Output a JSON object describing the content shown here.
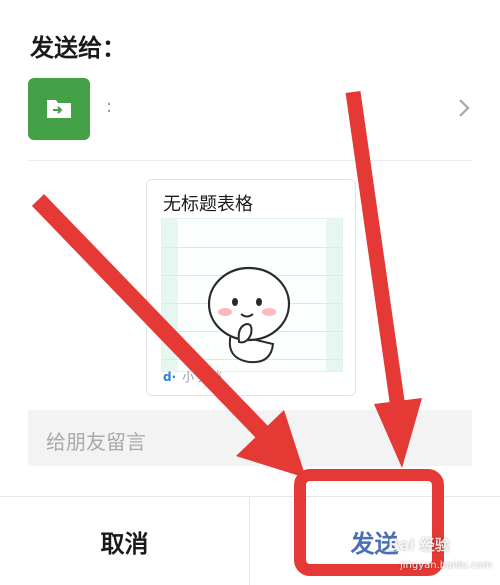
{
  "header": {
    "title": "发送给："
  },
  "recipient": {
    "name": ":",
    "icon": "forward-arrow-icon",
    "icon_color": "#43a047"
  },
  "card": {
    "title": "无标题表格",
    "footer_logo": "d·",
    "footer_text": "小 文档"
  },
  "message": {
    "placeholder": "给朋友留言"
  },
  "buttons": {
    "cancel": "取消",
    "send": "发送",
    "send_color": "#4a6fb5"
  },
  "annotations": {
    "arrow_color": "#e53935"
  },
  "watermark": {
    "text": "Bai 经验",
    "url": "jingyan.baidu.com"
  }
}
